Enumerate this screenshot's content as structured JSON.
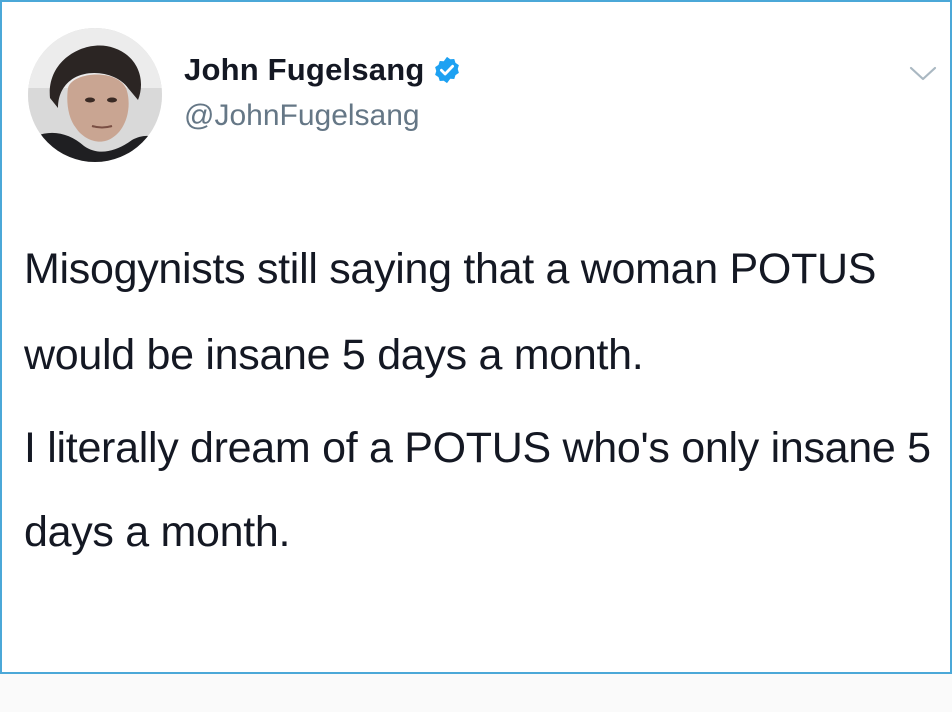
{
  "tweet": {
    "author": {
      "display_name": "John Fugelsang",
      "handle": "@JohnFugelsang",
      "verified": true,
      "avatar_icon": "profile-photo"
    },
    "text_paragraphs": [
      "Misogynists still saying that a woman POTUS would be insane 5 days a month.",
      "I literally dream of a POTUS who's only insane 5 days a month."
    ],
    "menu_icon": "chevron-down-icon"
  },
  "colors": {
    "border": "#4ba8d8",
    "verified_badge": "#1da1f2",
    "name": "#141823",
    "handle": "#657786",
    "text": "#141823"
  }
}
